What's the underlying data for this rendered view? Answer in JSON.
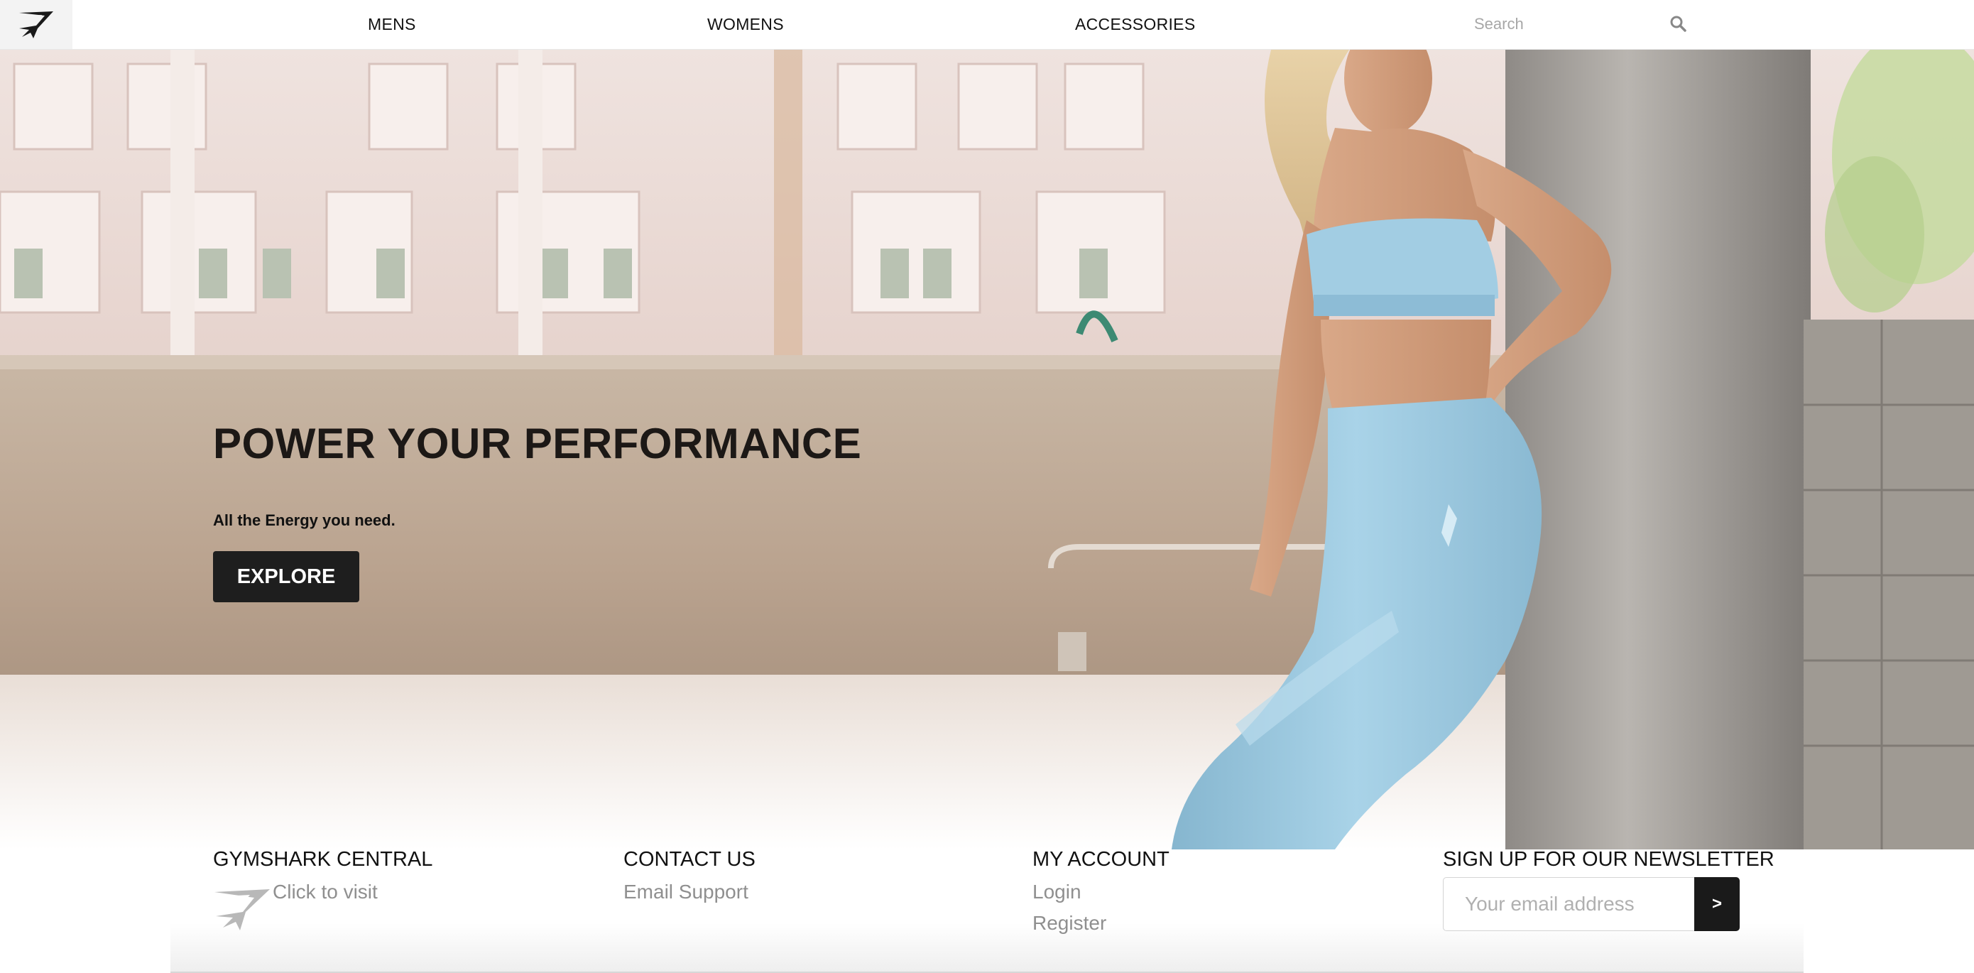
{
  "nav": {
    "links": [
      "MENS",
      "WOMENS",
      "ACCESSORIES"
    ],
    "search_placeholder": "Search"
  },
  "hero": {
    "title": "POWER YOUR PERFORMANCE",
    "subtitle": "All the Energy you need.",
    "cta_label": "EXPLORE"
  },
  "footer": {
    "central": {
      "heading": "GYMSHARK CENTRAL",
      "link": "Click to visit"
    },
    "contact": {
      "heading": "CONTACT US",
      "link": "Email Support"
    },
    "account": {
      "heading": "MY ACCOUNT",
      "links": [
        "Login",
        "Register"
      ]
    },
    "newsletter": {
      "heading": "SIGN UP FOR OUR NEWSLETTER",
      "placeholder": "Your email address",
      "submit_label": ">"
    }
  },
  "colors": {
    "button_dark": "#1e1e1e",
    "leggings_blue": "#9ccbe2",
    "link_gray": "#8f8f8f"
  },
  "icons": [
    "gymshark-logo-icon",
    "search-icon",
    "gymshark-small-logo-icon"
  ]
}
